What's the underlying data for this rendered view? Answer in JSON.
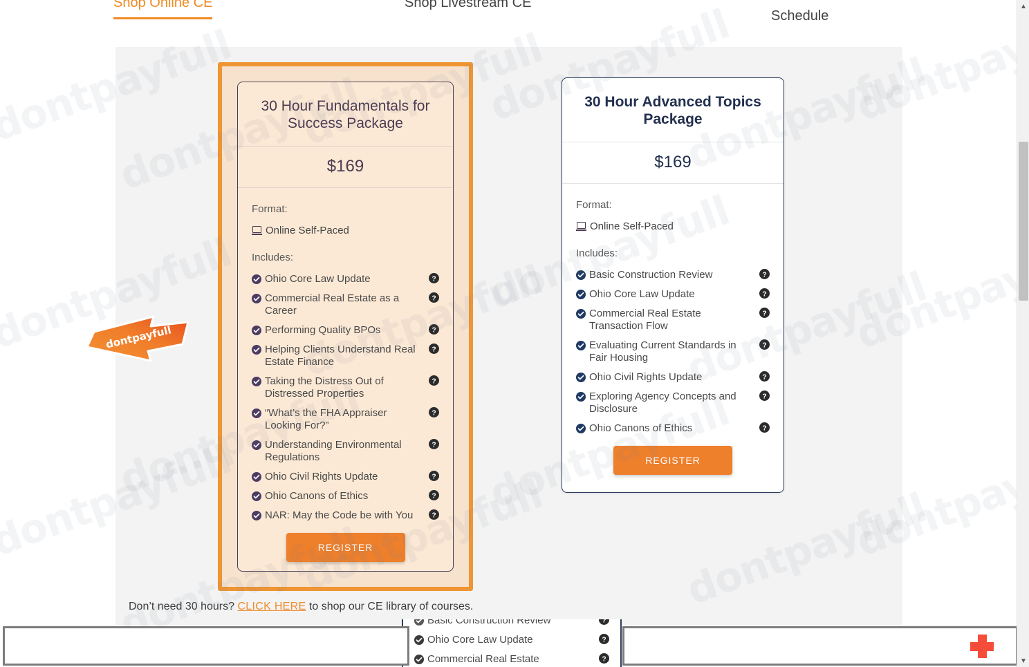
{
  "tabs": [
    {
      "id": "online",
      "label": "Shop Online CE",
      "active": true
    },
    {
      "id": "livestream",
      "label": "Shop Livestream CE",
      "active": false
    },
    {
      "id": "schedule",
      "label": "Schedule",
      "active": false
    }
  ],
  "colors": {
    "accent_orange": "#EE7F2B",
    "highlight_border": "#EF9534",
    "card1_bg": "#FCE9D5",
    "card2_border": "#2B3E5E",
    "panel_bg": "#F3F3F3",
    "link_orange": "#EE8A2B",
    "plus_red": "#F64C3A"
  },
  "packages": [
    {
      "id": "fundamentals",
      "title": "30 Hour Fundamentals for Success Package",
      "price": "$169",
      "format_label": "Format:",
      "format_value": "Online Self-Paced",
      "includes_label": "Includes:",
      "highlighted": true,
      "register_label": "REGISTER",
      "courses": [
        "Ohio Core Law Update",
        "Commercial Real Estate as a Career",
        "Performing Quality BPOs",
        "Helping Clients Understand Real Estate Finance",
        "Taking the Distress Out of Distressed Properties",
        "“What’s the FHA Appraiser Looking For?”",
        "Understanding Environmental Regulations",
        "Ohio Civil Rights Update",
        "Ohio Canons of Ethics",
        "NAR: May the Code be with You"
      ]
    },
    {
      "id": "advanced",
      "title": "30 Hour Advanced Topics Package",
      "price": "$169",
      "format_label": "Format:",
      "format_value": "Online Self-Paced",
      "includes_label": "Includes:",
      "highlighted": false,
      "register_label": "REGISTER",
      "courses": [
        "Basic Construction Review",
        "Ohio Core Law Update",
        "Commercial Real Estate Transaction Flow",
        "Evaluating Current Standards in Fair Housing",
        "Ohio Civil Rights Update",
        "Exploring Agency Concepts and Disclosure",
        "Ohio Canons of Ethics"
      ]
    }
  ],
  "footer": {
    "before_link": "Don’t need 30 hours? ",
    "link_text": "CLICK HERE",
    "after_link": " to shop our CE library of courses."
  },
  "overlay_popup": {
    "items": [
      "Basic Construction Review",
      "Ohio Core Law Update",
      "Commercial Real Estate"
    ]
  },
  "sticker": {
    "text": "dontpayfull"
  },
  "watermark": {
    "text": "dontpayfull"
  },
  "scrollbar": {
    "up_glyph": "▲",
    "down_glyph": "▼"
  }
}
